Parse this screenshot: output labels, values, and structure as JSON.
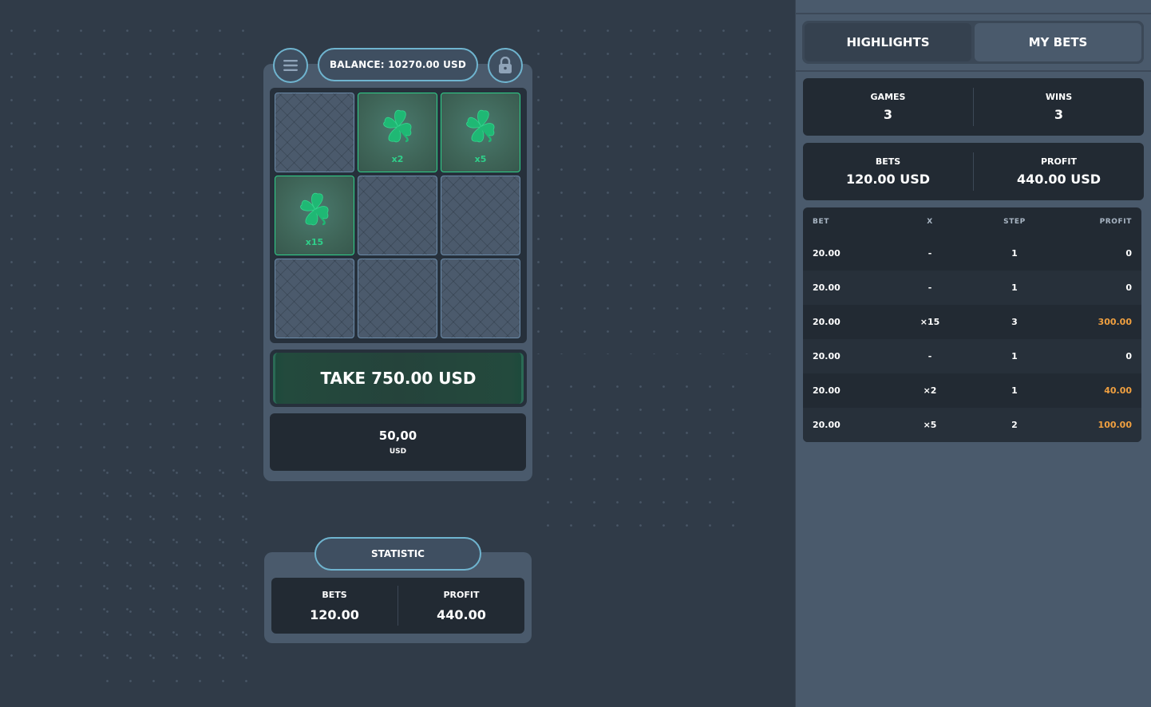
{
  "header": {
    "balance_label": "BALANCE: 10270.00 USD",
    "menu_icon": "hamburger-menu-icon",
    "lock_icon": "padlock-icon"
  },
  "grid": {
    "tiles": [
      {
        "revealed": false,
        "multiplier": ""
      },
      {
        "revealed": true,
        "multiplier": "x2"
      },
      {
        "revealed": true,
        "multiplier": "x5"
      },
      {
        "revealed": true,
        "multiplier": "x15"
      },
      {
        "revealed": false,
        "multiplier": ""
      },
      {
        "revealed": false,
        "multiplier": ""
      },
      {
        "revealed": false,
        "multiplier": ""
      },
      {
        "revealed": false,
        "multiplier": ""
      },
      {
        "revealed": false,
        "multiplier": ""
      }
    ],
    "tile_icon": "four-leaf-clover-icon"
  },
  "actions": {
    "take_label": "TAKE 750.00 USD",
    "bet_amount": "50,00",
    "bet_currency": "USD"
  },
  "statistic": {
    "title": "STATISTIC",
    "bets_label": "BETS",
    "bets_value": "120.00",
    "profit_label": "PROFIT",
    "profit_value": "440.00"
  },
  "sidebar": {
    "tabs": [
      {
        "label": "HIGHLIGHTS"
      },
      {
        "label": "MY BETS"
      }
    ],
    "summary": {
      "games_label": "GAMES",
      "games_value": "3",
      "wins_label": "WINS",
      "wins_value": "3",
      "bets_label": "BETS",
      "bets_value": "120.00 USD",
      "profit_label": "PROFIT",
      "profit_value": "440.00 USD"
    },
    "table": {
      "headers": {
        "bet": "BET",
        "x": "X",
        "step": "STEP",
        "profit": "PROFIT"
      },
      "rows": [
        {
          "bet": "20.00",
          "x": "-",
          "step": "1",
          "profit": "0",
          "win": false
        },
        {
          "bet": "20.00",
          "x": "-",
          "step": "1",
          "profit": "0",
          "win": false
        },
        {
          "bet": "20.00",
          "x": "×15",
          "step": "3",
          "profit": "300.00",
          "win": true
        },
        {
          "bet": "20.00",
          "x": "-",
          "step": "1",
          "profit": "0",
          "win": false
        },
        {
          "bet": "20.00",
          "x": "×2",
          "step": "1",
          "profit": "40.00",
          "win": true
        },
        {
          "bet": "20.00",
          "x": "×5",
          "step": "2",
          "profit": "100.00",
          "win": true
        }
      ]
    }
  },
  "colors": {
    "accent_green": "#2fd08a",
    "profit_orange": "#f0a040",
    "outline_blue": "#6fb4cf"
  }
}
